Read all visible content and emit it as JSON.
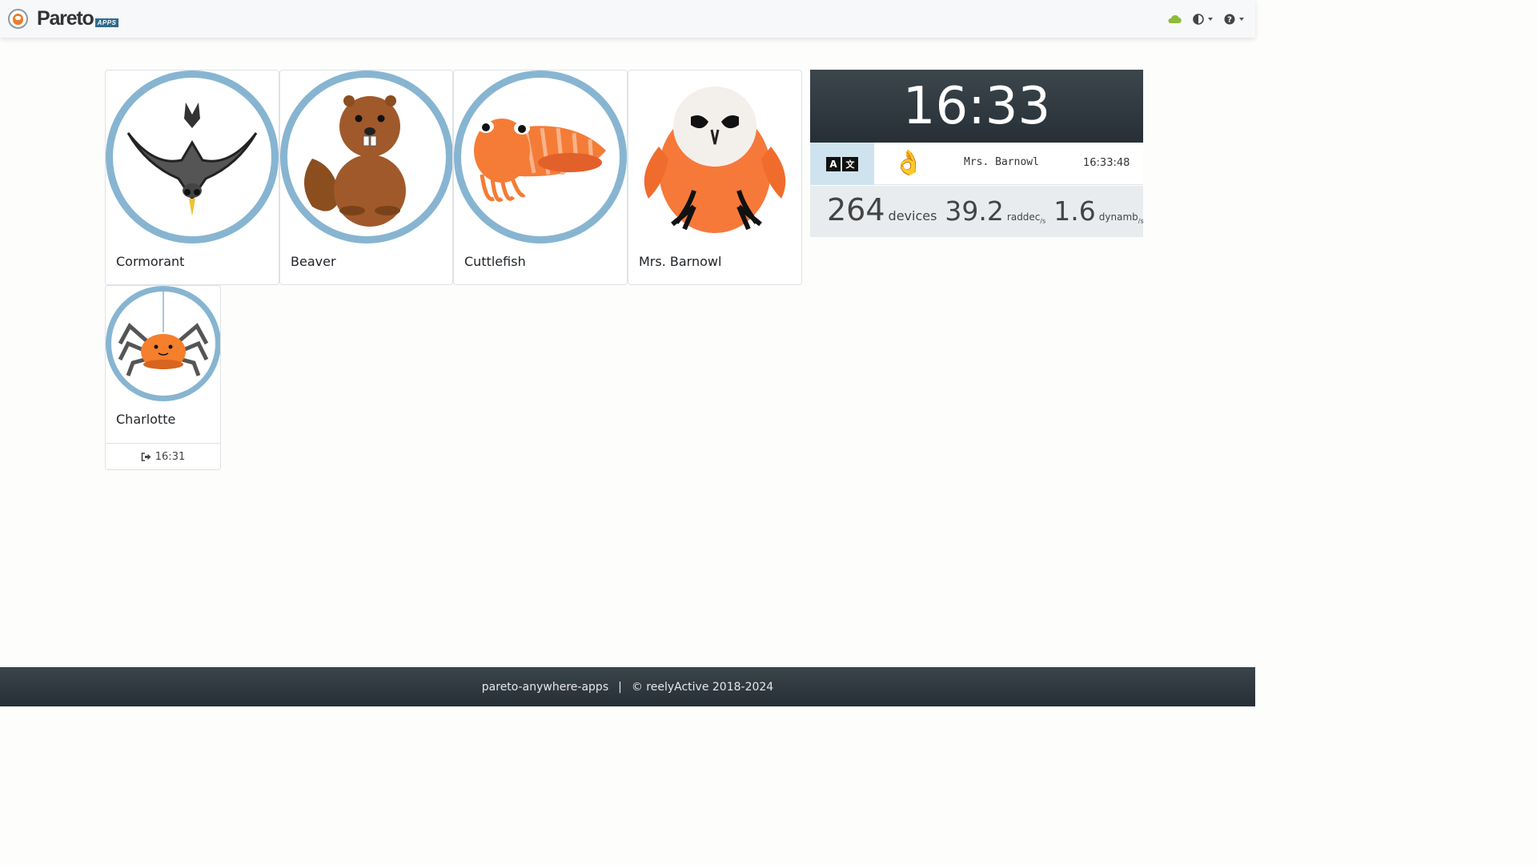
{
  "navbar": {
    "brand_name": "Pareto",
    "brand_badge": "APPS",
    "icons": [
      "cloud-icon",
      "theme-contrast-icon",
      "help-icon"
    ]
  },
  "cards": [
    {
      "name": "Cormorant",
      "ring": true
    },
    {
      "name": "Beaver",
      "ring": true
    },
    {
      "name": "Cuttlefish",
      "ring": true
    },
    {
      "name": "Mrs. Barnowl",
      "ring": false
    },
    {
      "name": "Charlotte",
      "ring": true,
      "footer_icon": "sign-out-icon",
      "footer_time": "16:31"
    }
  ],
  "panel": {
    "clock": "16:33",
    "language_left": "A",
    "language_right": "文",
    "status_emoji": "👌",
    "status_name": "Mrs. Barnowl",
    "status_time": "16:33:48",
    "stats": [
      {
        "value": "264",
        "unit": "devices",
        "sub": ""
      },
      {
        "value": "39.2",
        "unit": "raddec",
        "sub": "/s"
      },
      {
        "value": "1.6",
        "unit": "dynamb",
        "sub": "/s"
      }
    ]
  },
  "colors": {
    "ring": "#87b5d1",
    "cloud": "#8dbb3c",
    "footer_bg": "#2e373d",
    "clock_bg": "#2e373d"
  },
  "footer": {
    "project": "pareto-anywhere-apps",
    "separator": "|",
    "copyright": "© reelyActive 2018-2024"
  }
}
